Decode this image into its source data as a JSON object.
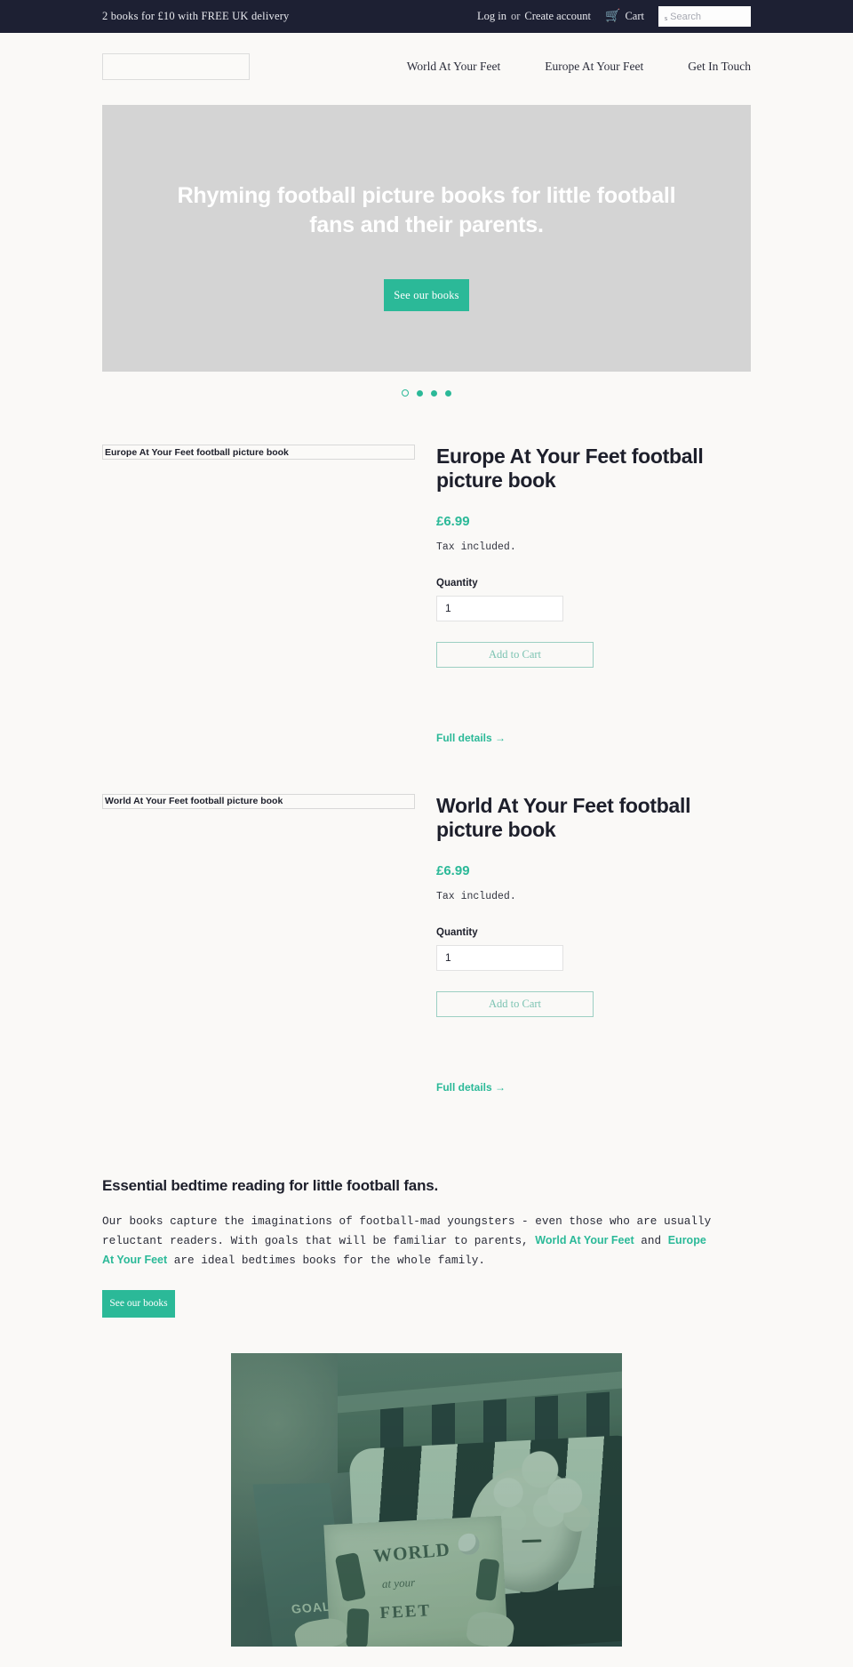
{
  "topbar": {
    "promo": "2 books for £10 with FREE UK delivery",
    "login_label": "Log in",
    "or_label": "or",
    "create_account_label": "Create account",
    "cart_label": "Cart",
    "cart_icon": "cart-icon",
    "search_icon": "search-icon",
    "search_glyph": "s",
    "search_value": "",
    "search_placeholder": "Search"
  },
  "header": {
    "logo_alt": "",
    "nav": [
      {
        "label": "World At Your Feet"
      },
      {
        "label": "Europe At Your Feet"
      },
      {
        "label": "Get In Touch"
      }
    ]
  },
  "hero": {
    "heading": "Rhyming football picture books for little football fans and their parents.",
    "cta_label": "See our books",
    "dots": [
      {
        "active": true
      },
      {
        "active": false
      },
      {
        "active": false
      },
      {
        "active": false
      }
    ]
  },
  "products": [
    {
      "image_alt": "Europe At Your Feet football picture book",
      "title": "Europe At Your Feet football picture book",
      "price": "£6.99",
      "tax_note": "Tax included.",
      "quantity_label": "Quantity",
      "quantity_value": "1",
      "add_to_cart_label": "Add to Cart",
      "full_details_label": "Full details →"
    },
    {
      "image_alt": "World At Your Feet football picture book",
      "title": "World At Your Feet football picture book",
      "price": "£6.99",
      "tax_note": "Tax included.",
      "quantity_label": "Quantity",
      "quantity_value": "1",
      "add_to_cart_label": "Add to Cart",
      "full_details_label": "Full details →"
    }
  ],
  "feature": {
    "heading": "Essential bedtime reading for little football fans.",
    "body_part1": "Our books capture the imaginations of football-mad youngsters - even those who are usually reluctant readers. With goals that will be familiar to parents, ",
    "link1": "World At Your Feet",
    "body_part2": " and ",
    "link2": "Europe At Your Feet",
    "body_part3": " are ideal bedtimes books for the whole family.",
    "cta_label": "See our books"
  },
  "photo": {
    "alt": "Child in bed reading the World At Your Feet picture book",
    "book_cover_line1": "WORLD",
    "book_cover_line2": "at your",
    "book_cover_line3": "FEET",
    "back_cover_text": "GOAL!"
  },
  "colors": {
    "accent": "#2bb998",
    "topbar_bg": "#1d2033",
    "page_bg": "#faf9f7",
    "hero_bg": "#d4d4d4",
    "text": "#1d1f2b"
  }
}
